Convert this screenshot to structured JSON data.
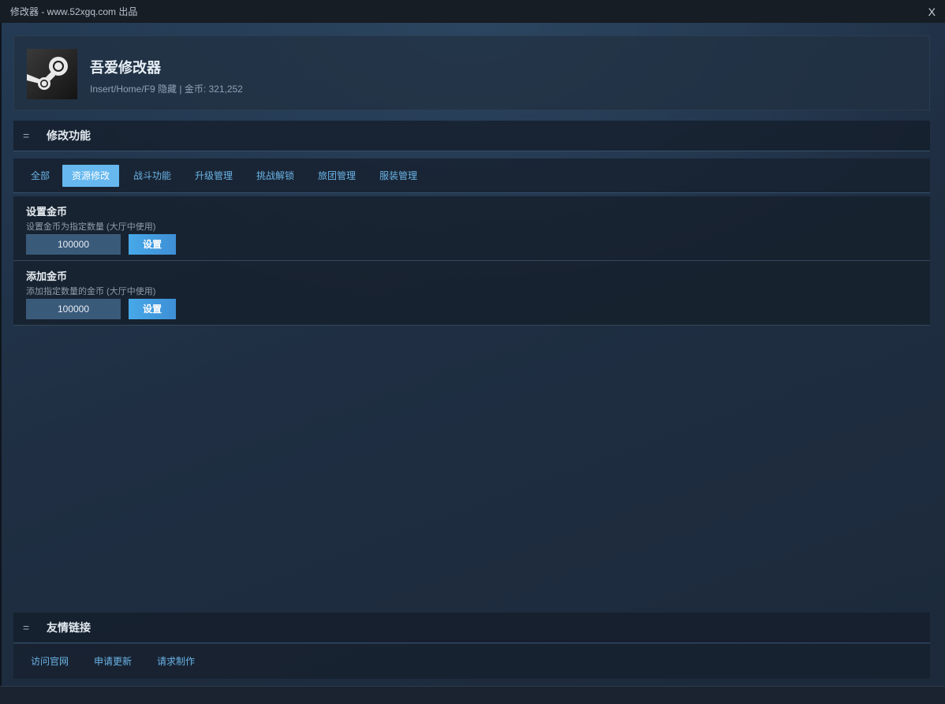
{
  "window": {
    "title": "修改器 - www.52xgq.com 出品",
    "close_label": "X"
  },
  "profile": {
    "app_name": "吾爱修改器",
    "subtitle": "Insert/Home/F9 隐藏 | 金币: 321,252",
    "avatar_icon": "steam-logo-icon"
  },
  "section_features": {
    "title": "修改功能",
    "icon_glyph": "="
  },
  "tabs": [
    {
      "label": "全部"
    },
    {
      "label": "资源修改",
      "active": true
    },
    {
      "label": "战斗功能"
    },
    {
      "label": "升级管理"
    },
    {
      "label": "挑战解锁"
    },
    {
      "label": "旅团管理"
    },
    {
      "label": "服装管理"
    }
  ],
  "features": [
    {
      "title": "设置金币",
      "desc": "设置金币为指定数量 (大厅中使用)",
      "value": "100000",
      "button": "设置"
    },
    {
      "title": "添加金币",
      "desc": "添加指定数量的金币 (大厅中使用)",
      "value": "100000",
      "button": "设置"
    }
  ],
  "section_links": {
    "title": "友情链接",
    "icon_glyph": "="
  },
  "links": [
    {
      "label": "访问官网"
    },
    {
      "label": "申请更新"
    },
    {
      "label": "请求制作"
    }
  ],
  "colors": {
    "accent": "#66b8ef",
    "button": "#47a8e8",
    "link": "#6bb4e6",
    "background": "#1b2433"
  }
}
